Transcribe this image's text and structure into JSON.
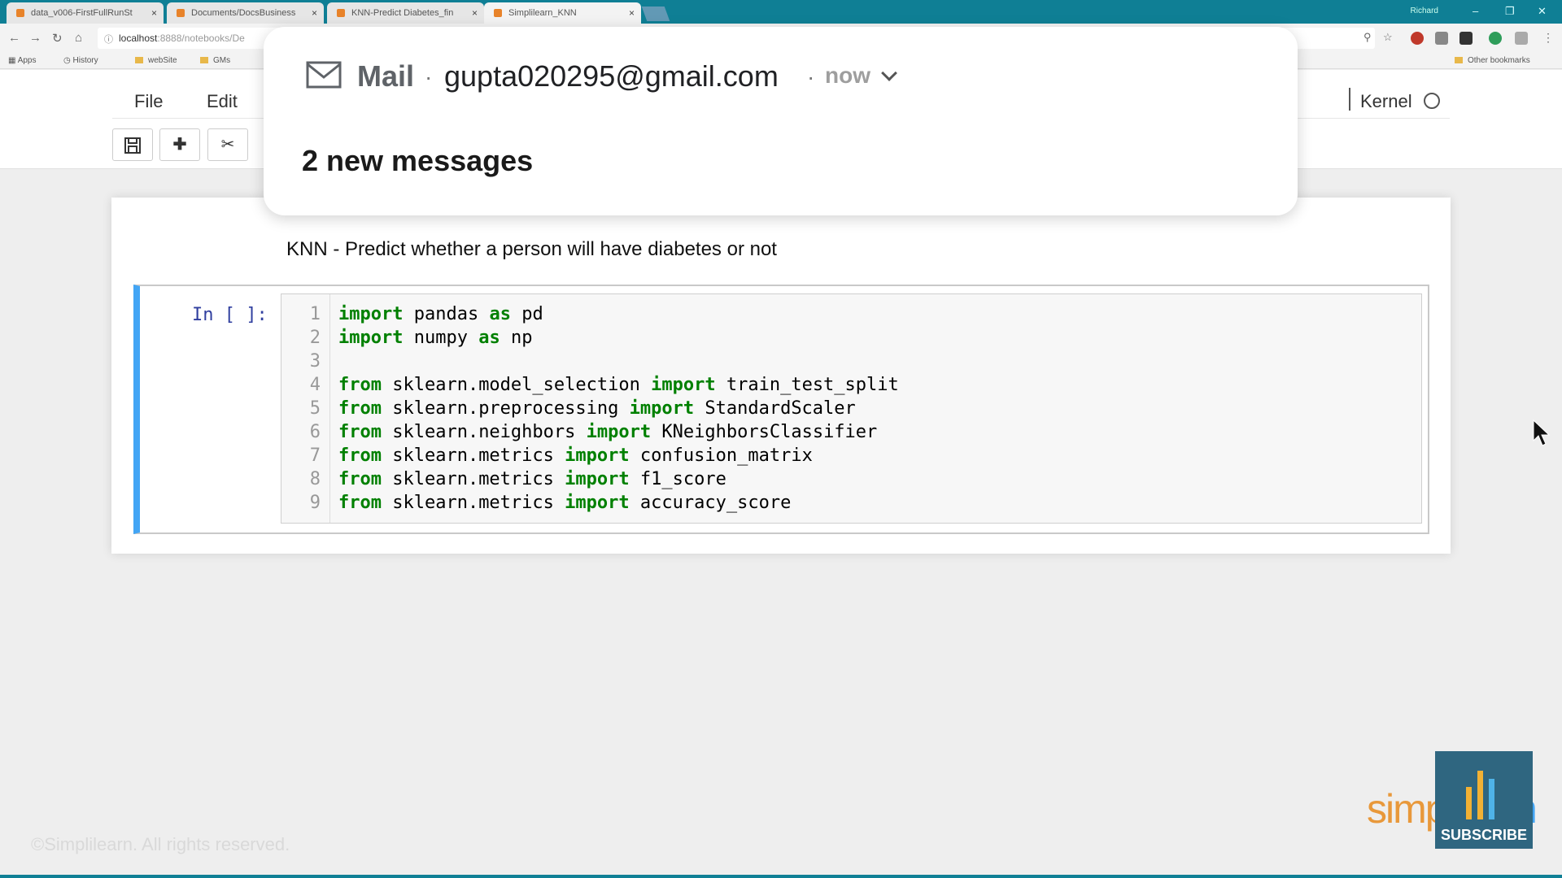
{
  "browser": {
    "tabs": [
      {
        "label": "data_v006-FirstFullRunSt"
      },
      {
        "label": "Documents/DocsBusiness"
      },
      {
        "label": "KNN-Predict Diabetes_fin"
      },
      {
        "label": "Simplilearn_KNN"
      }
    ],
    "close_glyph": "×",
    "window_user": "Richard",
    "url_host": "localhost",
    "url_rest": ":8888/notebooks/De",
    "bookmarks": [
      "Apps",
      "History",
      "webSite",
      "GMs"
    ],
    "other_bookmarks": "Other bookmarks"
  },
  "jupyter": {
    "menu": {
      "file": "File",
      "edit": "Edit",
      "kernel": "Kernel"
    },
    "toolbar_icons": [
      "save-icon",
      "plus-icon",
      "cut-icon"
    ]
  },
  "notebook": {
    "markdown_text": "KNN - Predict whether a person will have diabetes or not",
    "cell_prompt": "In [ ]:",
    "code_lines": [
      {
        "n": "1",
        "tokens": [
          {
            "t": "import",
            "kw": true
          },
          {
            "t": " pandas "
          },
          {
            "t": "as",
            "kw": true
          },
          {
            "t": " pd"
          }
        ]
      },
      {
        "n": "2",
        "tokens": [
          {
            "t": "import",
            "kw": true
          },
          {
            "t": " numpy "
          },
          {
            "t": "as",
            "kw": true
          },
          {
            "t": " np"
          }
        ]
      },
      {
        "n": "3",
        "tokens": []
      },
      {
        "n": "4",
        "tokens": [
          {
            "t": "from",
            "kw": true
          },
          {
            "t": " sklearn.model_selection "
          },
          {
            "t": "import",
            "kw": true
          },
          {
            "t": " train_test_split"
          }
        ]
      },
      {
        "n": "5",
        "tokens": [
          {
            "t": "from",
            "kw": true
          },
          {
            "t": " sklearn.preprocessing "
          },
          {
            "t": "import",
            "kw": true
          },
          {
            "t": " StandardScaler"
          }
        ]
      },
      {
        "n": "6",
        "tokens": [
          {
            "t": "from",
            "kw": true
          },
          {
            "t": " sklearn.neighbors "
          },
          {
            "t": "import",
            "kw": true
          },
          {
            "t": " KNeighborsClassifier"
          }
        ]
      },
      {
        "n": "7",
        "tokens": [
          {
            "t": "from",
            "kw": true
          },
          {
            "t": " sklearn.metrics "
          },
          {
            "t": "import",
            "kw": true
          },
          {
            "t": " confusion_matrix"
          }
        ]
      },
      {
        "n": "8",
        "tokens": [
          {
            "t": "from",
            "kw": true
          },
          {
            "t": " sklearn.metrics "
          },
          {
            "t": "import",
            "kw": true
          },
          {
            "t": " f1_score"
          }
        ]
      },
      {
        "n": "9",
        "tokens": [
          {
            "t": "from",
            "kw": true
          },
          {
            "t": " sklearn.metrics "
          },
          {
            "t": "import",
            "kw": true
          },
          {
            "t": " accuracy_score"
          }
        ]
      }
    ]
  },
  "notification": {
    "app": "Mail",
    "separator": "·",
    "account": "gupta020295@gmail.com",
    "time": "now",
    "body": "2 new messages"
  },
  "branding": {
    "logo_left": "simpl",
    "logo_right": "learn",
    "subscribe": "SUBSCRIBE",
    "copyright": "©Simplilearn. All rights reserved."
  },
  "colors": {
    "tabbar": "#0f7f95",
    "cell_selected_border": "#42a5f5",
    "keyword": "#008000",
    "prompt": "#303f9f",
    "brand_orange": "#e8983a",
    "brand_blue": "#42a5f5"
  }
}
